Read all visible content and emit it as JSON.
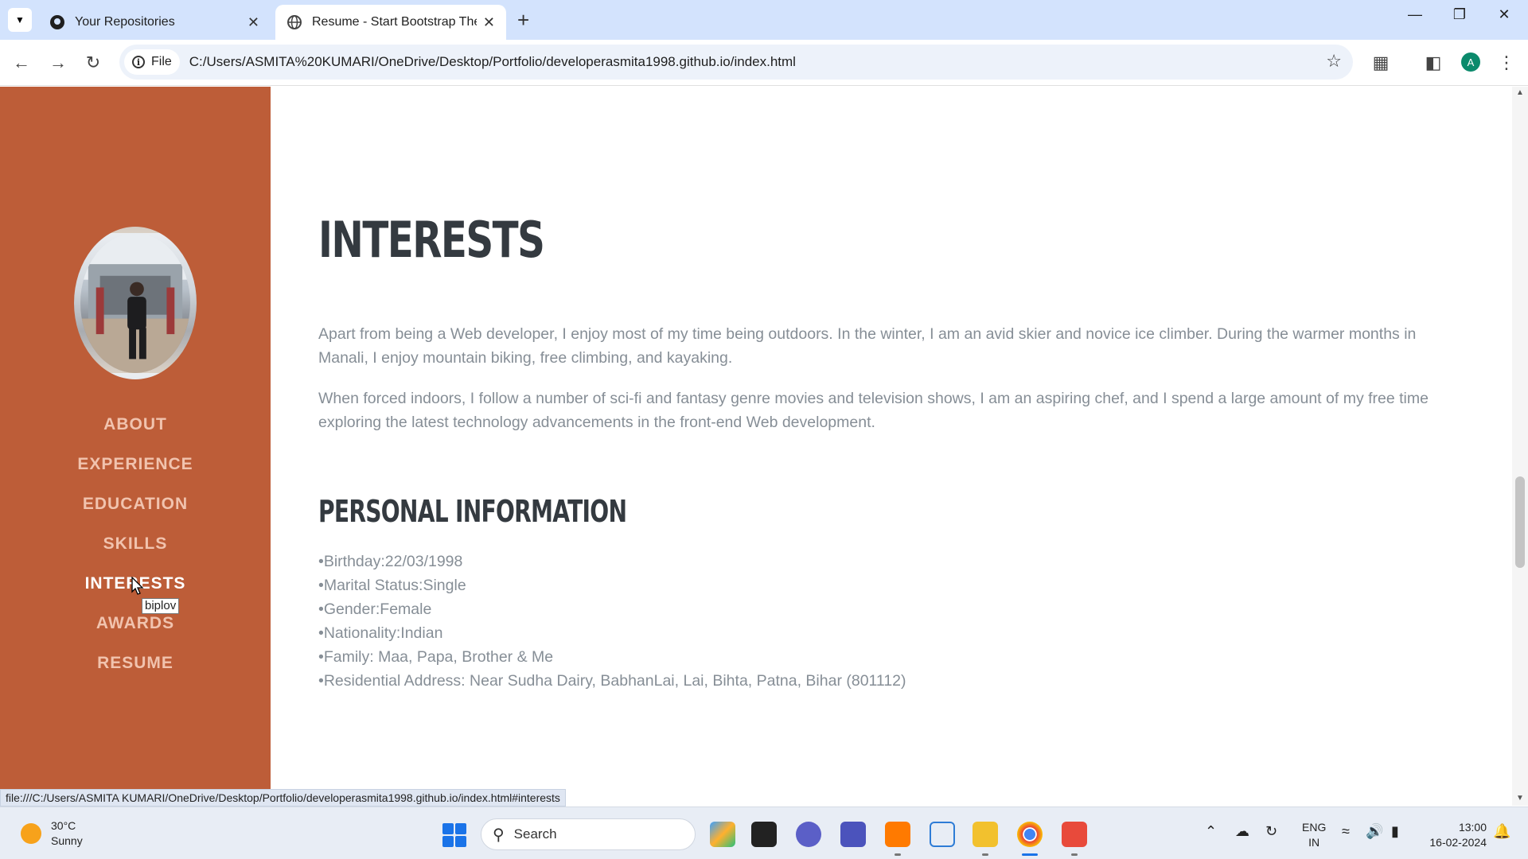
{
  "browser": {
    "tabs": [
      {
        "title": "Your Repositories",
        "active": false,
        "icon": "github-icon"
      },
      {
        "title": "Resume - Start Bootstrap Them",
        "active": true,
        "icon": "globe-icon"
      }
    ],
    "address_chip": "File",
    "url": "C:/Users/ASMITA%20KUMARI/OneDrive/Desktop/Portfolio/developerasmita1998.github.io/index.html",
    "profile_initial": "A",
    "status_url": "file:///C:/Users/ASMITA KUMARI/OneDrive/Desktop/Portfolio/developerasmita1998.github.io/index.html#interests"
  },
  "sidebar": {
    "accent": "#bd5d38",
    "nav": [
      {
        "label": "ABOUT"
      },
      {
        "label": "EXPERIENCE"
      },
      {
        "label": "EDUCATION"
      },
      {
        "label": "SKILLS"
      },
      {
        "label": "INTERESTS",
        "current": true
      },
      {
        "label": "AWARDS"
      },
      {
        "label": "RESUME"
      }
    ],
    "tooltip": "biplov"
  },
  "main": {
    "title": "INTERESTS",
    "paragraphs": [
      "Apart from being a Web developer, I enjoy most of my time being outdoors. In the winter, I am an avid skier and novice ice climber. During the warmer months in Manali, I enjoy mountain biking, free climbing, and kayaking.",
      "When forced indoors, I follow a number of sci-fi and fantasy genre movies and television shows, I am an aspiring chef, and I spend a large amount of my free time exploring the latest technology advancements in the front-end Web development."
    ],
    "personal_title": "PERSONAL INFORMATION",
    "personal_info": [
      "Birthday:22/03/1998",
      "Marital Status:Single",
      "Gender:Female",
      "Nationality:Indian",
      "Family: Maa, Papa, Brother & Me",
      "Residential Address: Near Sudha Dairy, BabhanLai, Lai, Bihta, Patna, Bihar (801112)"
    ]
  },
  "taskbar": {
    "weather_temp": "30°C",
    "weather_desc": "Sunny",
    "search_placeholder": "Search",
    "lang_line1": "ENG",
    "lang_line2": "IN",
    "time": "13:00",
    "date": "16-02-2024"
  }
}
